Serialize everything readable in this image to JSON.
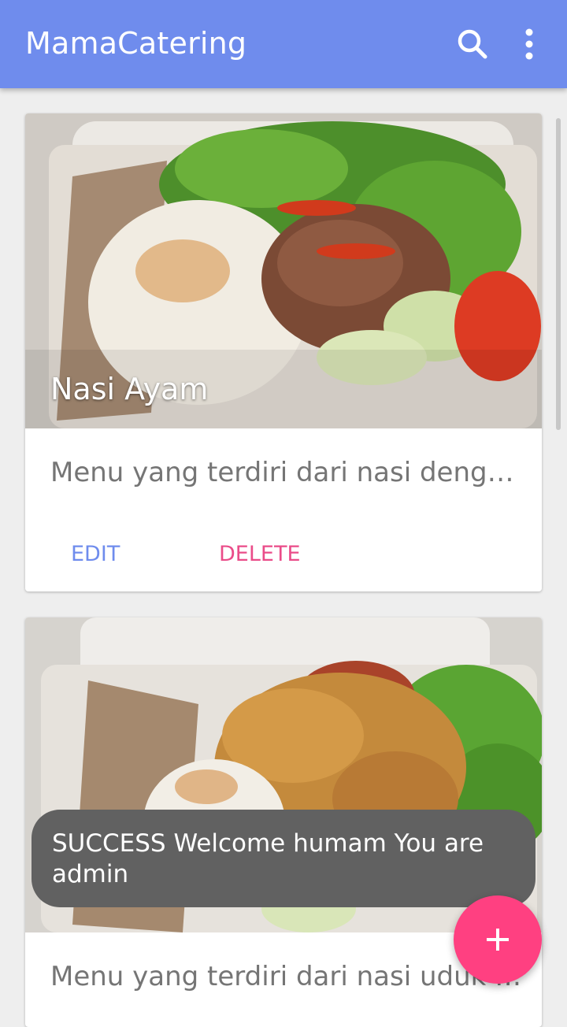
{
  "app": {
    "title": "MamaCatering",
    "accent_color": "#6f8ced",
    "actions": [
      {
        "name": "search",
        "icon": "search-icon"
      },
      {
        "name": "more",
        "icon": "more-vert-icon"
      }
    ]
  },
  "menu_items": [
    {
      "title": "Nasi Ayam",
      "description": "Menu yang terdiri dari nasi dengan lauk ayam",
      "image": "food-photo",
      "actions": {
        "edit": "EDIT",
        "delete": "DELETE"
      }
    },
    {
      "title": "",
      "description": "Menu yang terdiri dari nasi uduk dengan ayam goreng",
      "image": "food-photo"
    }
  ],
  "snackbar": {
    "message": "SUCCESS Welcome humam You are admin"
  },
  "fab": {
    "icon": "add-icon",
    "color": "#ff4081"
  }
}
